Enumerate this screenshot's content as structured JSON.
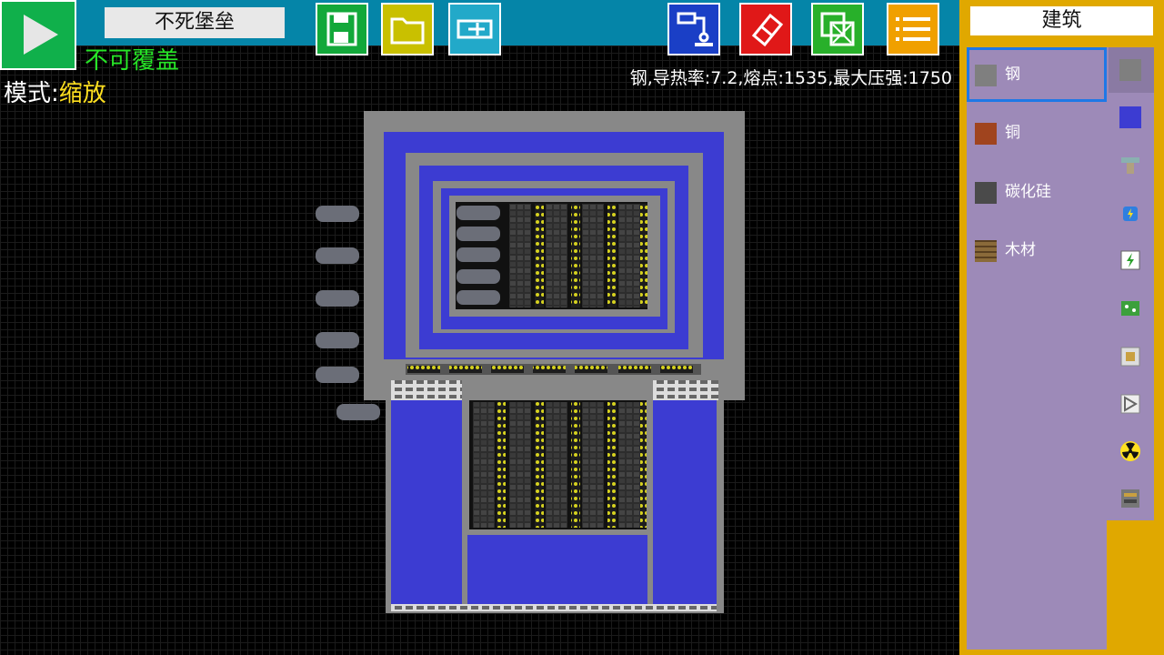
{
  "title": "不死堡垒",
  "overwrite_status": "不可覆盖",
  "mode": {
    "label": "模式:",
    "value": "缩放"
  },
  "selected_info": "钢,导热率:7.2,熔点:1535,最大压强:1750",
  "toolbar": {
    "play": "play-icon",
    "save": "save-icon",
    "open": "folder-icon",
    "edit": "edit-icon",
    "robot": "robot-arm-icon",
    "eraser": "eraser-icon",
    "copy": "copy-icon",
    "menu": "menu-icon"
  },
  "panel": {
    "title": "建筑",
    "materials": [
      {
        "label": "钢",
        "color": "#7f7f7f",
        "selected": true
      },
      {
        "label": "铜",
        "color": "#a0441e",
        "selected": false
      },
      {
        "label": "碳化硅",
        "color": "#4a4a4a",
        "selected": false
      },
      {
        "label": "木材",
        "color": "#8a6a3a",
        "selected": false
      }
    ],
    "categories": [
      "wall-category-icon",
      "water-block-icon",
      "pipe-category-icon",
      "engine-category-icon",
      "electric-category-icon",
      "circuit-category-icon",
      "logic-gate-icon",
      "diode-icon",
      "radiation-icon",
      "machine-category-icon"
    ]
  },
  "colors": {
    "steel": "#888888",
    "coolant": "#3c3cd2",
    "bar": "#0585a8",
    "panel": "#e0a800",
    "list": "#9d8ab8"
  }
}
